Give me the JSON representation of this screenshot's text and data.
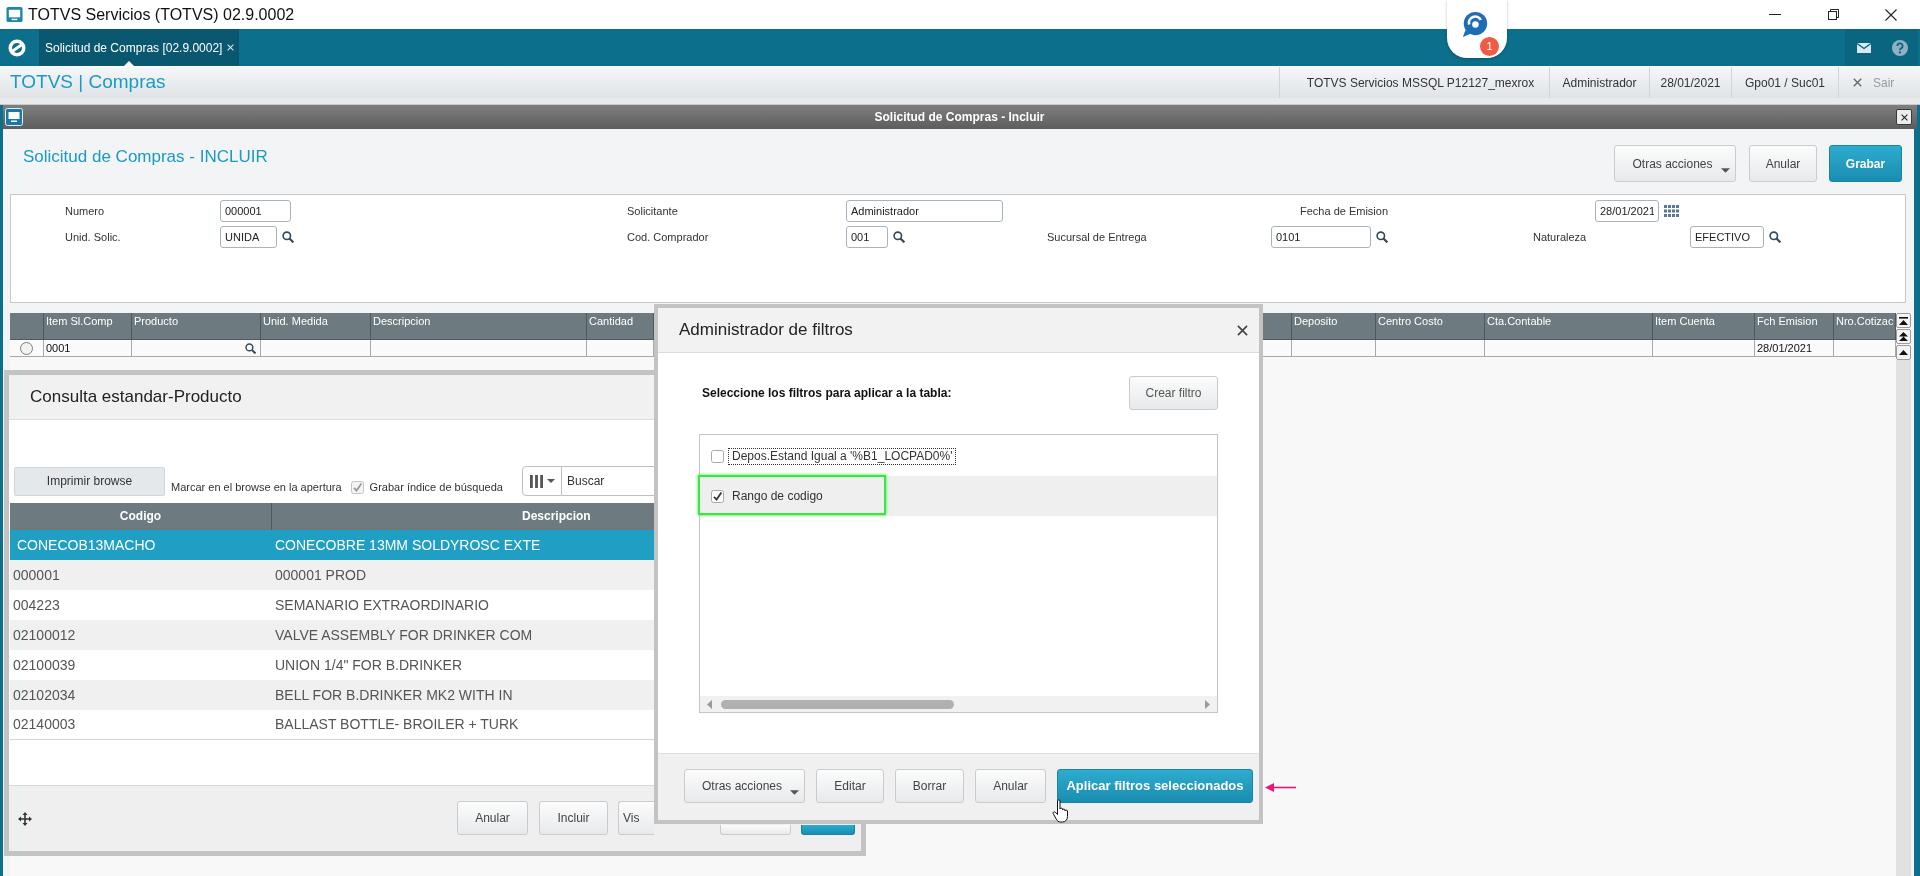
{
  "title_bar": {
    "title": "TOTVS Servicios (TOTVS) 02.9.0002"
  },
  "app_bar": {
    "tabs": [
      {
        "label": "Solicitud de Compras [02.9.0002]",
        "selected": true
      }
    ],
    "notifications": "1"
  },
  "module_bar": {
    "title": "TOTVS | Compras",
    "info": [
      "TOTVS Servicios MSSQL P12127_mexrox",
      "Administrador",
      "28/01/2021",
      "Gpo01 / Suc01"
    ],
    "exit": "Sair"
  },
  "window": {
    "title": "Solicitud de Compras - Incluir",
    "heading": "Solicitud de Compras - INCLUIR",
    "actions": [
      {
        "label": "Otras acciones",
        "kind": "menu"
      },
      {
        "label": "Anular",
        "kind": "default"
      },
      {
        "label": "Grabar",
        "kind": "primary"
      }
    ]
  },
  "form": {
    "rows": [
      [
        {
          "label": "Numero",
          "value": "000001",
          "kind": "text"
        },
        {
          "label": "Solicitante",
          "value": "Administrador",
          "kind": "text"
        },
        {
          "label": "Fecha de Emision",
          "value": "28/01/2021",
          "kind": "date"
        }
      ],
      [
        {
          "label": "Unid. Solic.",
          "value": "UNIDA",
          "kind": "lookup"
        },
        {
          "label": "Cod. Comprador",
          "value": "001",
          "kind": "lookup"
        },
        {
          "label": "Sucursal de Entrega",
          "value": "0101",
          "kind": "lookup"
        },
        {
          "label": "Naturaleza",
          "value": "EFECTIVO",
          "kind": "lookup"
        }
      ]
    ]
  },
  "grid": {
    "columns": [
      {
        "label": "Item Sl.Comp",
        "kind": "text"
      },
      {
        "label": "Producto",
        "kind": "lookup"
      },
      {
        "label": "Unid. Medida",
        "kind": "text"
      },
      {
        "label": "Descripcion",
        "kind": "text"
      },
      {
        "label": "Cantidad",
        "kind": "text"
      },
      {
        "label": "Deposito",
        "kind": "text"
      },
      {
        "label": "Centro Costo",
        "kind": "text"
      },
      {
        "label": "Cta.Contable",
        "kind": "text"
      },
      {
        "label": "Item Cuenta",
        "kind": "text"
      },
      {
        "label": "Fch Emision",
        "kind": "text"
      },
      {
        "label": "Nro.Cotizac",
        "kind": "text"
      }
    ],
    "rows": [
      {
        "selected": false,
        "item_sl_comp": "0001",
        "fch_emision": "28/01/2021"
      }
    ]
  },
  "lookup_dialog": {
    "title": "Consulta estandar-Producto",
    "print_button": "Imprimir browse",
    "note": "Marcar en el browse en la apertura",
    "option": {
      "label": "Grabar índice de búsqueda",
      "checked": true,
      "disabled": true
    },
    "search": {
      "placeholder": "Buscar"
    },
    "columns": [
      "Codigo",
      "Descripcion"
    ],
    "rows": [
      {
        "codigo": "CONECOB13MACHO",
        "descripcion": "CONECOBRE 13MM SOLDYROSC EXTE",
        "selected": true
      },
      {
        "codigo": "000001",
        "descripcion": "000001 PROD",
        "selected": false
      },
      {
        "codigo": "004223",
        "descripcion": "SEMANARIO EXTRAORDINARIO",
        "selected": false
      },
      {
        "codigo": "02100012",
        "descripcion": "VALVE ASSEMBLY FOR DRINKER COM",
        "selected": false
      },
      {
        "codigo": "02100039",
        "descripcion": "UNION 1/4\" FOR B.DRINKER",
        "selected": false
      },
      {
        "codigo": "02102034",
        "descripcion": "BELL FOR B.DRINKER MK2 WITH IN",
        "selected": false
      },
      {
        "codigo": "02140003",
        "descripcion": "BALLAST BOTTLE- BROILER + TURK",
        "selected": false
      }
    ],
    "buttons": [
      {
        "label": "Anular",
        "kind": "default"
      },
      {
        "label": "Incluir",
        "kind": "default"
      },
      {
        "label": "Vis",
        "kind": "default"
      },
      {
        "kind": "default"
      },
      {
        "kind": "primary"
      }
    ]
  },
  "filter_dialog": {
    "title": "Administrador de filtros",
    "prompt": "Seleccione los filtros para aplicar a la tabla:",
    "create_button": "Crear filtro",
    "filters": [
      {
        "label": "Depos.Estand Igual a '%B1_LOCPAD0%'",
        "checked": false,
        "selected": false,
        "focused": true,
        "annotated": false
      },
      {
        "label": "Rango de codigo",
        "checked": true,
        "selected": true,
        "focused": false,
        "annotated": true
      }
    ],
    "buttons": [
      {
        "label": "Otras acciones",
        "kind": "menu",
        "annotated": false
      },
      {
        "label": "Editar",
        "kind": "default",
        "annotated": false
      },
      {
        "label": "Borrar",
        "kind": "default",
        "annotated": false
      },
      {
        "label": "Anular",
        "kind": "default",
        "annotated": false
      },
      {
        "label": "Aplicar filtros seleccionados",
        "kind": "primary",
        "annotated": true
      }
    ]
  }
}
